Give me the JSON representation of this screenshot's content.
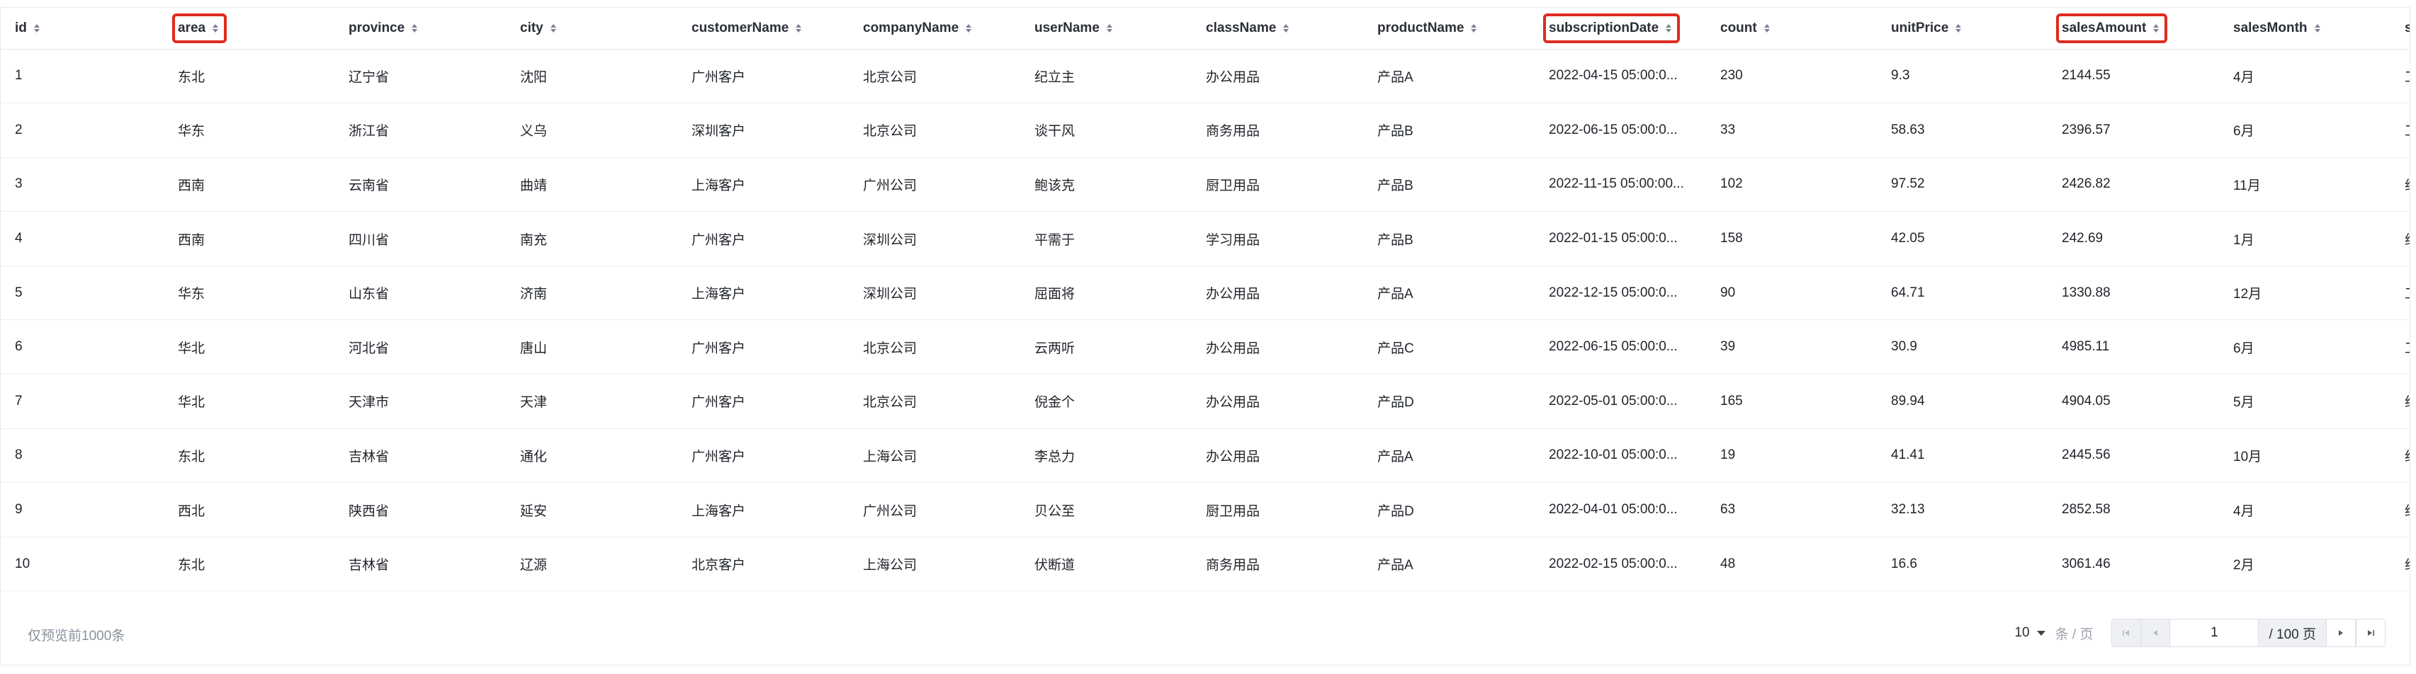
{
  "table": {
    "columns": [
      {
        "key": "id",
        "label": "id",
        "highlighted": false
      },
      {
        "key": "area",
        "label": "area",
        "highlighted": true
      },
      {
        "key": "province",
        "label": "province",
        "highlighted": false
      },
      {
        "key": "city",
        "label": "city",
        "highlighted": false
      },
      {
        "key": "customerName",
        "label": "customerName",
        "highlighted": false
      },
      {
        "key": "companyName",
        "label": "companyName",
        "highlighted": false
      },
      {
        "key": "userName",
        "label": "userName",
        "highlighted": false
      },
      {
        "key": "className",
        "label": "className",
        "highlighted": false
      },
      {
        "key": "productName",
        "label": "productName",
        "highlighted": false
      },
      {
        "key": "subscriptionDate",
        "label": "subscriptionDate",
        "highlighted": true
      },
      {
        "key": "count",
        "label": "count",
        "highlighted": false
      },
      {
        "key": "unitPrice",
        "label": "unitPrice",
        "highlighted": false
      },
      {
        "key": "salesAmount",
        "label": "salesAmount",
        "highlighted": true
      },
      {
        "key": "salesMonth",
        "label": "salesMonth",
        "highlighted": false
      },
      {
        "key": "s",
        "label": "s",
        "highlighted": false
      }
    ],
    "rows": [
      [
        "1",
        "东北",
        "辽宁省",
        "沈阳",
        "广州客户",
        "北京公司",
        "纪立主",
        "办公用品",
        "产品A",
        "2022-04-15 05:00:0...",
        "230",
        "9.3",
        "2144.55",
        "4月",
        "工"
      ],
      [
        "2",
        "华东",
        "浙江省",
        "义乌",
        "深圳客户",
        "北京公司",
        "谈干风",
        "商务用品",
        "产品B",
        "2022-06-15 05:00:0...",
        "33",
        "58.63",
        "2396.57",
        "6月",
        "工"
      ],
      [
        "3",
        "西南",
        "云南省",
        "曲靖",
        "上海客户",
        "广州公司",
        "鲍该克",
        "厨卫用品",
        "产品B",
        "2022-11-15 05:00:00...",
        "102",
        "97.52",
        "2426.82",
        "11月",
        "约"
      ],
      [
        "4",
        "西南",
        "四川省",
        "南充",
        "广州客户",
        "深圳公司",
        "平需于",
        "学习用品",
        "产品B",
        "2022-01-15 05:00:0...",
        "158",
        "42.05",
        "242.69",
        "1月",
        "约"
      ],
      [
        "5",
        "华东",
        "山东省",
        "济南",
        "上海客户",
        "深圳公司",
        "屈面将",
        "办公用品",
        "产品A",
        "2022-12-15 05:00:0...",
        "90",
        "64.71",
        "1330.88",
        "12月",
        "工"
      ],
      [
        "6",
        "华北",
        "河北省",
        "唐山",
        "广州客户",
        "北京公司",
        "云两听",
        "办公用品",
        "产品C",
        "2022-06-15 05:00:0...",
        "39",
        "30.9",
        "4985.11",
        "6月",
        "工"
      ],
      [
        "7",
        "华北",
        "天津市",
        "天津",
        "广州客户",
        "北京公司",
        "倪金个",
        "办公用品",
        "产品D",
        "2022-05-01 05:00:0...",
        "165",
        "89.94",
        "4904.05",
        "5月",
        "约"
      ],
      [
        "8",
        "东北",
        "吉林省",
        "通化",
        "广州客户",
        "上海公司",
        "李总力",
        "办公用品",
        "产品A",
        "2022-10-01 05:00:0...",
        "19",
        "41.41",
        "2445.56",
        "10月",
        "约"
      ],
      [
        "9",
        "西北",
        "陕西省",
        "延安",
        "上海客户",
        "广州公司",
        "贝公至",
        "厨卫用品",
        "产品D",
        "2022-04-01 05:00:0...",
        "63",
        "32.13",
        "2852.58",
        "4月",
        "约"
      ],
      [
        "10",
        "东北",
        "吉林省",
        "辽源",
        "北京客户",
        "上海公司",
        "伏断道",
        "商务用品",
        "产品A",
        "2022-02-15 05:00:0...",
        "48",
        "16.6",
        "3061.46",
        "2月",
        "约"
      ]
    ]
  },
  "footer": {
    "note": "仅预览前1000条",
    "page_size": "10",
    "page_size_unit": "条 / 页",
    "current_page": "1",
    "total_pages": "/ 100 页"
  },
  "colors": {
    "highlight_border": "#e02b20",
    "header_text": "#2b2f36",
    "muted_text": "#8a909c"
  },
  "icons": {
    "sort": "sort-icon",
    "first_page": "first-page-icon",
    "prev_page": "prev-page-icon",
    "next_page": "next-page-icon",
    "last_page": "last-page-icon",
    "dropdown": "chevron-down-icon"
  }
}
